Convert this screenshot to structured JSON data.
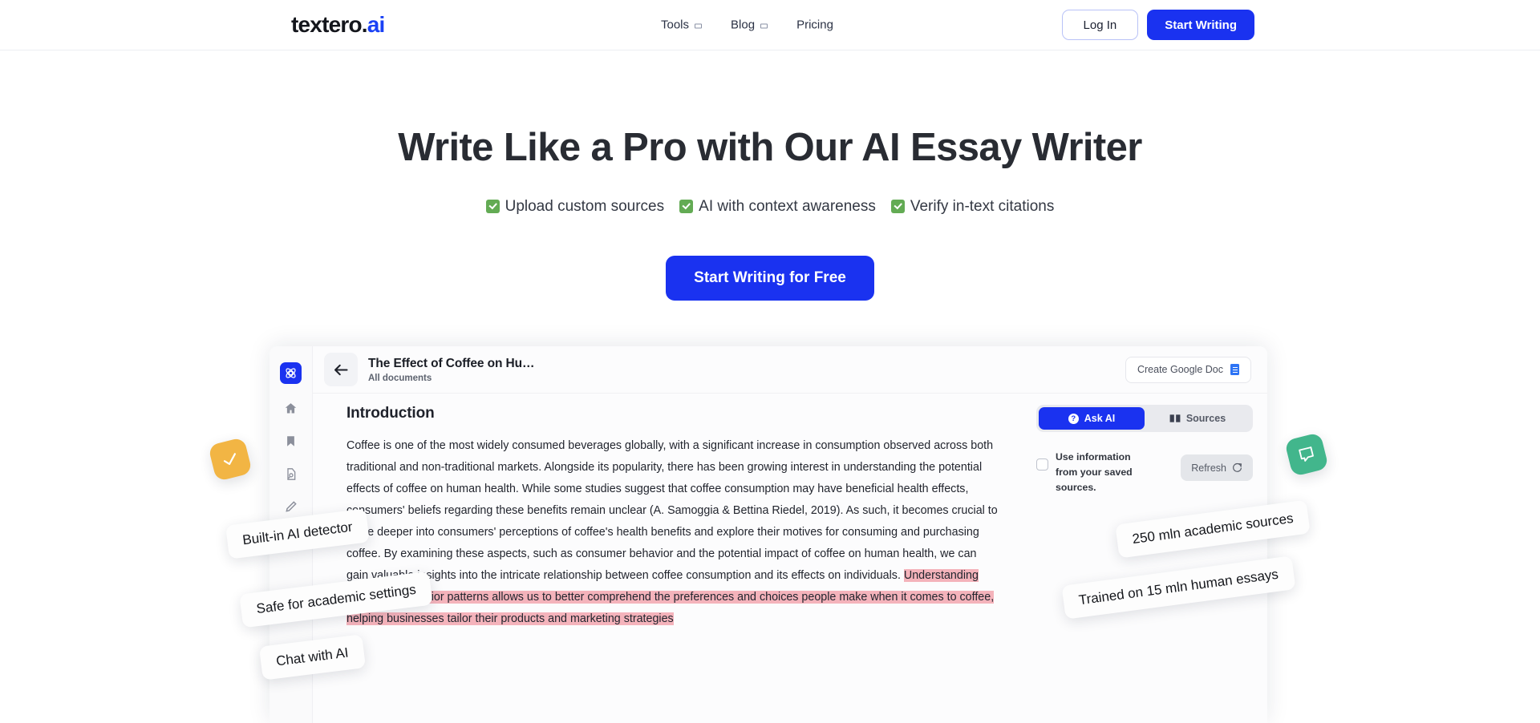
{
  "brand": {
    "name_main": "textero",
    "name_dot": ".",
    "name_accent": "ai",
    "accent_color": "#1a41f5",
    "primary_color": "#1a32f0"
  },
  "navbar": {
    "links": [
      {
        "label": "Tools",
        "has_dropdown": true,
        "icon": "chevron-down-icon"
      },
      {
        "label": "Blog",
        "has_dropdown": true,
        "icon": "chevron-down-icon"
      },
      {
        "label": "Pricing",
        "has_dropdown": false
      }
    ],
    "login_label": "Log In",
    "start_writing_label": "Start Writing"
  },
  "hero": {
    "title": "Write Like a Pro with Our AI Essay Writer",
    "features": [
      {
        "icon": "check-mark-button-emoji",
        "label": "Upload custom sources"
      },
      {
        "icon": "check-mark-button-emoji",
        "label": "AI with context awareness"
      },
      {
        "icon": "check-mark-button-emoji",
        "label": "Verify in-text citations"
      }
    ],
    "cta_label": "Start Writing for Free"
  },
  "badges": {
    "yellow": {
      "icon": "check-icon",
      "color": "#f2b544"
    },
    "green": {
      "icon": "chat-bubble-icon",
      "color": "#42b68c"
    }
  },
  "pills": {
    "left": [
      "Built-in AI detector",
      "Safe for academic settings",
      "Chat with AI"
    ],
    "right": [
      "250 mln academic sources",
      "Trained on 15 mln human essays"
    ]
  },
  "app_mock": {
    "sidebar": {
      "logo_icon": "atom-logo-icon",
      "items": [
        {
          "icon": "home-icon",
          "name": "home"
        },
        {
          "icon": "bookmark-icon",
          "name": "saved"
        },
        {
          "icon": "document-search-icon",
          "name": "sources"
        },
        {
          "icon": "pencil-icon",
          "name": "write"
        }
      ]
    },
    "topbar": {
      "back_icon": "arrow-left-icon",
      "doc_title": "The Effect of Coffee on Hu…",
      "breadcrumb": "All documents",
      "google_doc_label": "Create Google Doc",
      "google_doc_icon": "google-doc-icon"
    },
    "document": {
      "heading": "Introduction",
      "body_plain": "Coffee is one of the most widely consumed beverages globally, with a significant increase in consumption observed across both traditional and non-traditional markets. Alongside its popularity, there has been growing interest in understanding the potential effects of coffee on human health. While some studies suggest that coffee consumption may have beneficial health effects, consumers' beliefs regarding these benefits remain unclear (A. Samoggia & Bettina Riedel, 2019). As such, it becomes crucial to delve deeper into consumers' perceptions of coffee's health benefits and explore their motives for consuming and purchasing coffee. By examining these aspects, such as consumer behavior and the potential impact of coffee on human health, we can gain valuable insights into the intricate relationship between coffee consumption and its effects on individuals. ",
      "body_highlighted": "Understanding consumer behavior patterns allows us to better comprehend the preferences and choices people make when it comes to coffee, helping businesses tailor their products and marketing strategies",
      "highlight_color": "#f4b3bb"
    },
    "ai_panel": {
      "tabs": [
        {
          "label": "Ask AI",
          "icon": "question-mark-icon",
          "active": true
        },
        {
          "label": "Sources",
          "icon": "book-icon",
          "active": false
        }
      ],
      "checkbox_label": "Use information from your saved sources.",
      "checkbox_checked": false,
      "refresh_label": "Refresh",
      "refresh_icon": "refresh-icon"
    }
  }
}
